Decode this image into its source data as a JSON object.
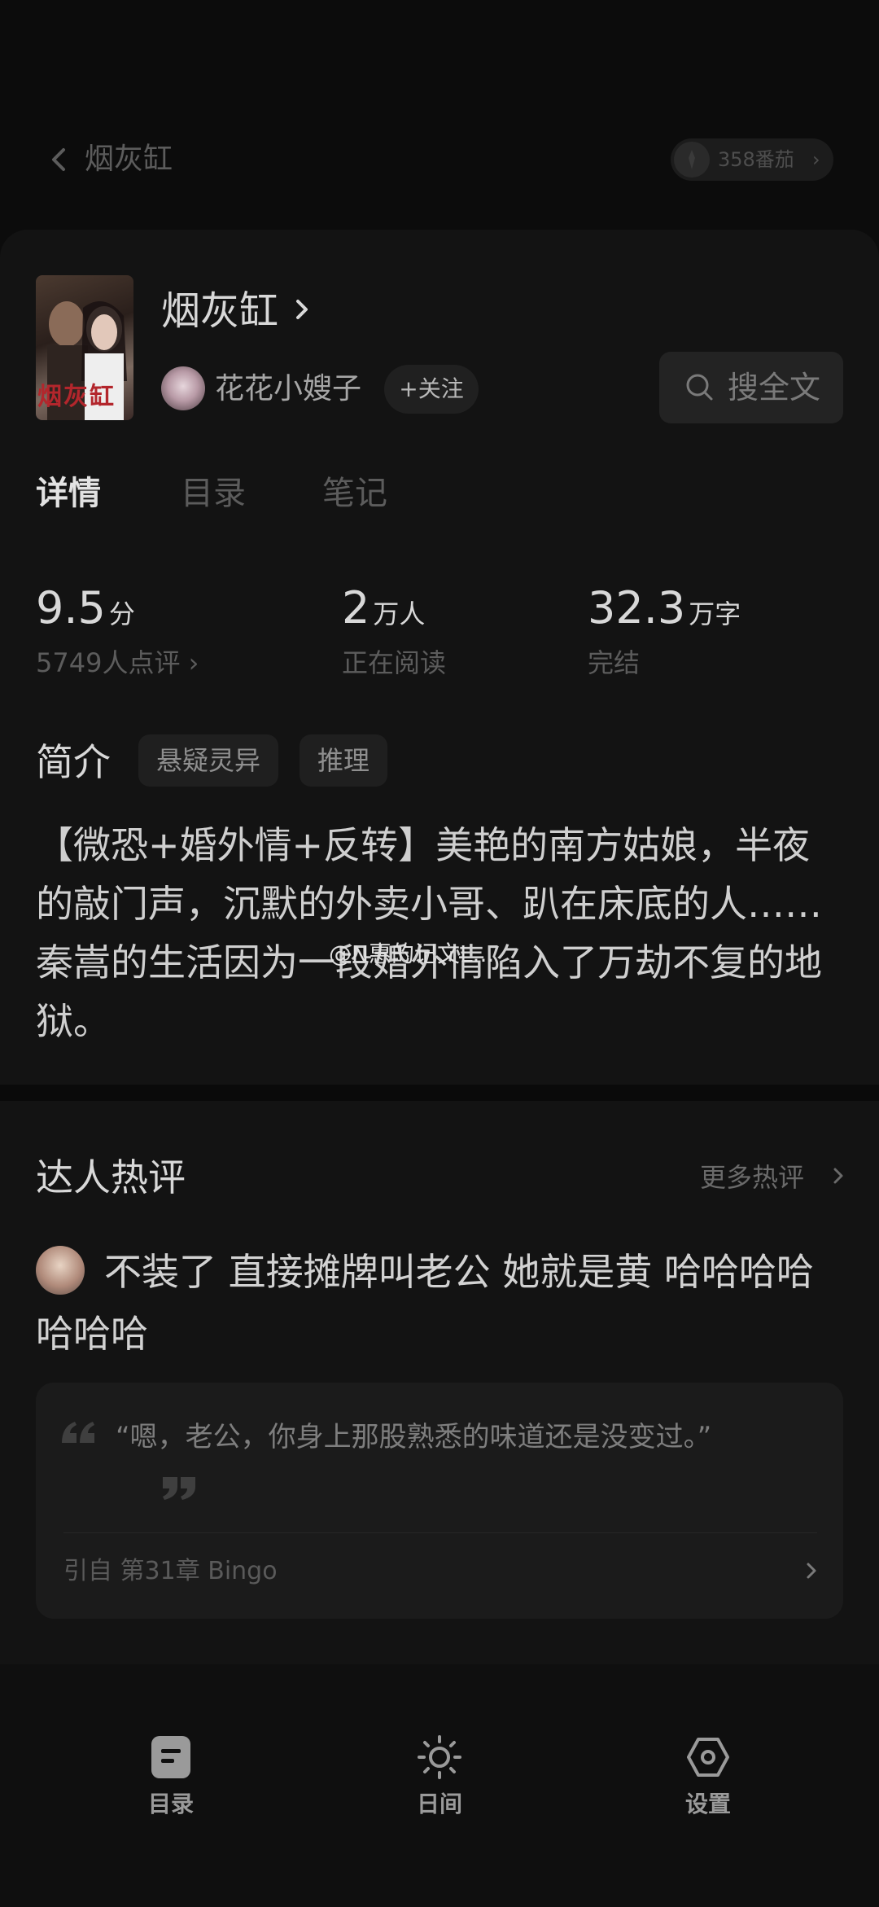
{
  "nav": {
    "title": "烟灰缸",
    "coins": "358番茄"
  },
  "book": {
    "title": "烟灰缸",
    "cover_text": "烟灰缸",
    "author": "花花小嫂子",
    "follow_label": "+关注",
    "search_label": "搜全文"
  },
  "tabs": [
    {
      "label": "详情"
    },
    {
      "label": "目录"
    },
    {
      "label": "笔记"
    }
  ],
  "stats": [
    {
      "value": "9.5",
      "unit": "分",
      "sub": "5749人点评 ›"
    },
    {
      "value": "2",
      "unit": "万人",
      "sub": "正在阅读"
    },
    {
      "value": "32.3",
      "unit": "万字",
      "sub": "完结"
    }
  ],
  "intro": {
    "heading": "简介",
    "tags": [
      "悬疑灵异",
      "推理"
    ],
    "text": "【微恐+婚外情+反转】美艳的南方姑娘，半夜的敲门声，沉默的外卖小哥、趴在床底的人……秦嵩的生活因为一段婚外情陷入了万劫不复的地狱。",
    "watermark": "@N惠的记文L..."
  },
  "hot_comments": {
    "heading": "达人热评",
    "more_label": "更多热评",
    "comment_text": "不装了 直接摊牌叫老公 她就是黄 哈哈哈哈哈哈哈",
    "quote_text": "“嗯，老公，你身上那股熟悉的味道还是没变过。”",
    "quote_source": "引自 第31章 Bingo"
  },
  "bottom_bar": [
    {
      "label": "目录",
      "icon": "catalog-icon"
    },
    {
      "label": "日间",
      "icon": "sun-icon"
    },
    {
      "label": "设置",
      "icon": "settings-icon"
    }
  ]
}
